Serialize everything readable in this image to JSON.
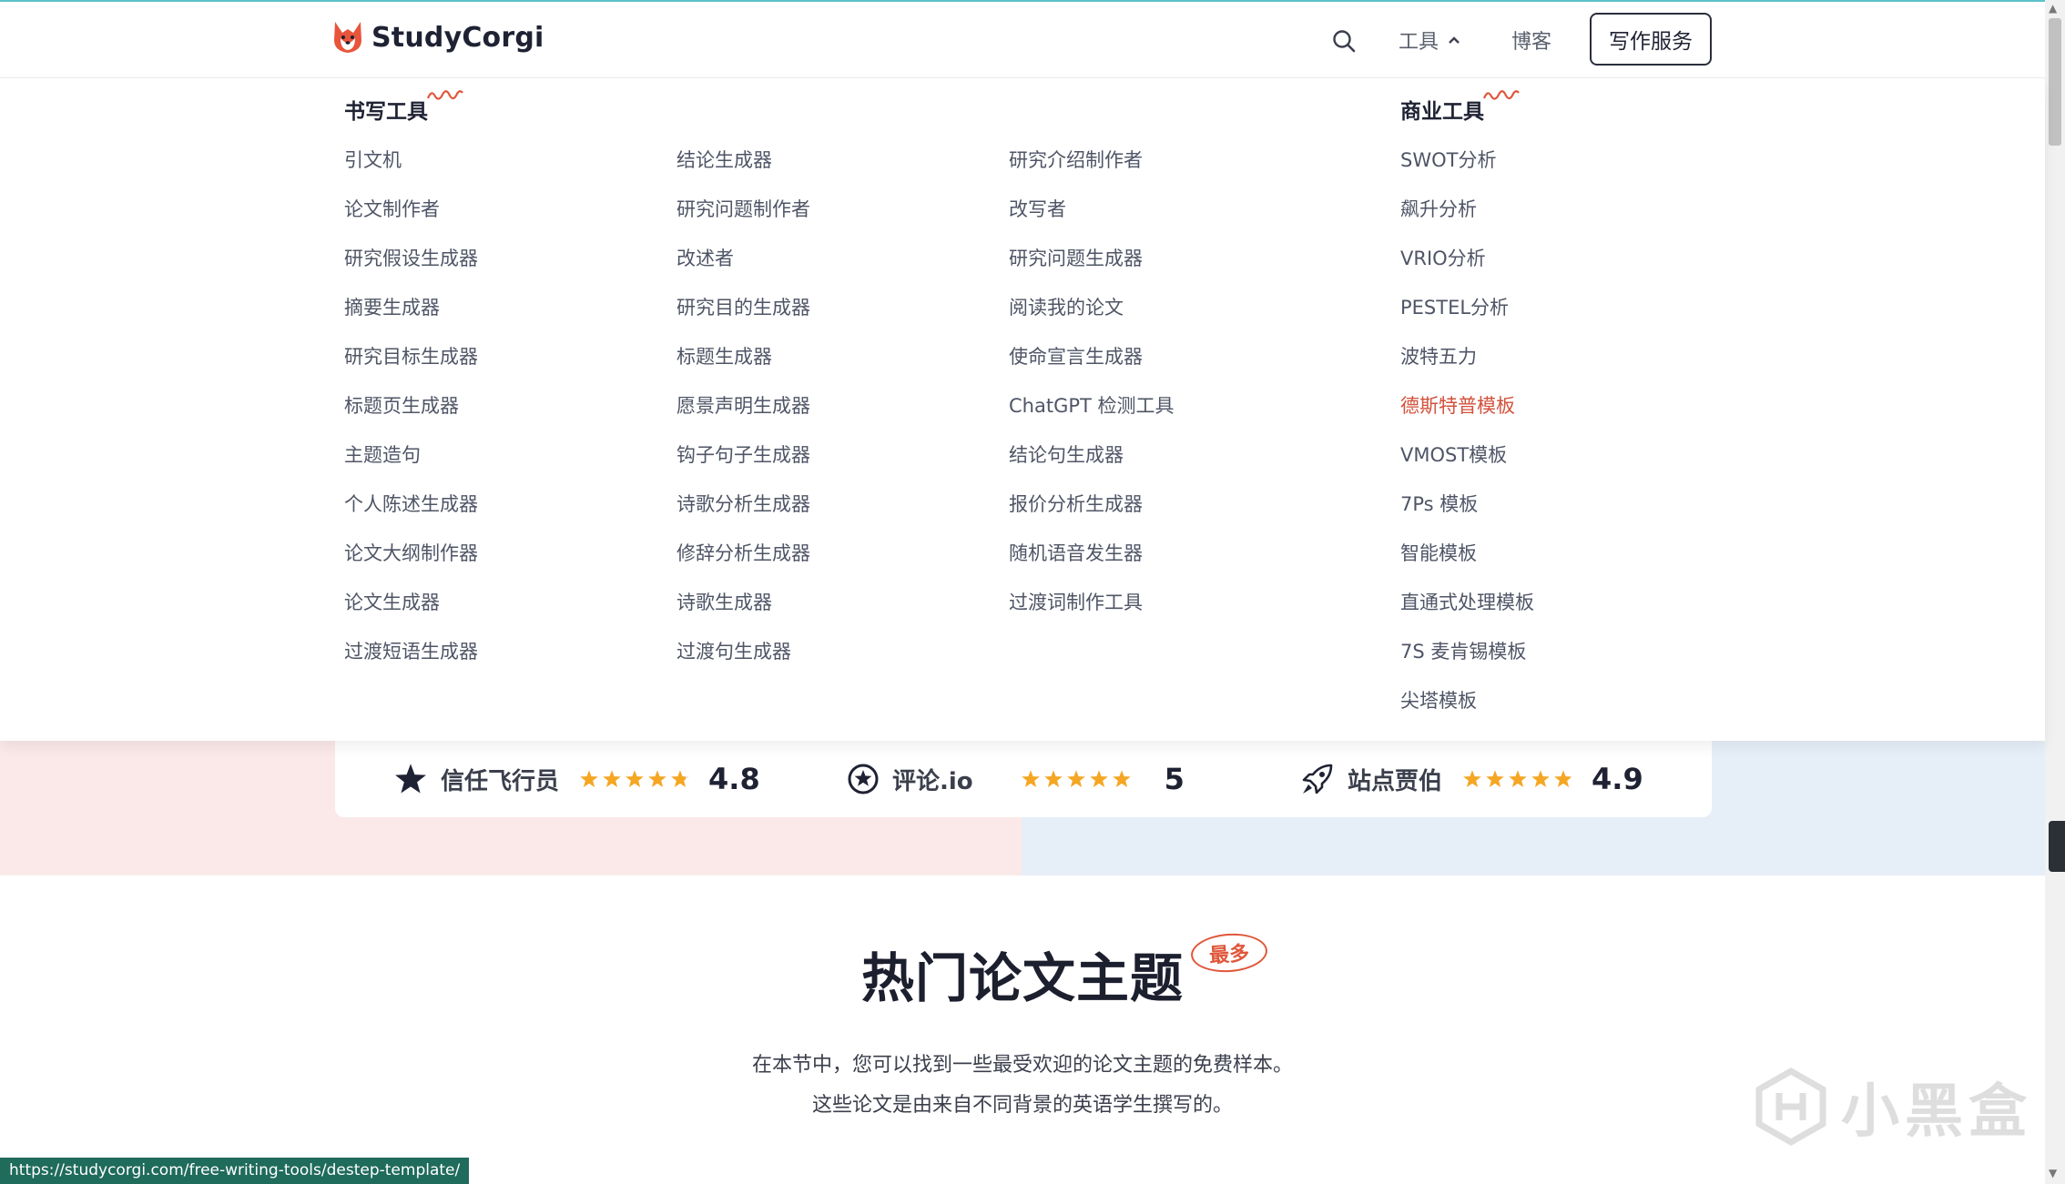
{
  "header": {
    "logo_text": "StudyCorgi",
    "tools_label": "工具",
    "blog_label": "博客",
    "cta_label": "写作服务"
  },
  "dropdown": {
    "writing_title": "书写工具",
    "business_title": "商业工具",
    "col1": [
      "引文机",
      "论文制作者",
      "研究假设生成器",
      "摘要生成器",
      "研究目标生成器",
      "标题页生成器",
      "主题造句",
      "个人陈述生成器",
      "论文大纲制作器",
      "论文生成器",
      "过渡短语生成器"
    ],
    "col2": [
      "结论生成器",
      "研究问题制作者",
      "改述者",
      "研究目的生成器",
      "标题生成器",
      "愿景声明生成器",
      "钩子句子生成器",
      "诗歌分析生成器",
      "修辞分析生成器",
      "诗歌生成器",
      "过渡句生成器"
    ],
    "col3": [
      "研究介绍制作者",
      "改写者",
      "研究问题生成器",
      "阅读我的论文",
      "使命宣言生成器",
      "ChatGPT 检测工具",
      "结论句生成器",
      "报价分析生成器",
      "随机语音发生器",
      "过渡词制作工具"
    ],
    "col4": [
      "SWOT分析",
      "飙升分析",
      "VRIO分析",
      "PESTEL分析",
      "波特五力",
      "德斯特普模板",
      "VMOST模板",
      "7Ps 模板",
      "智能模板",
      "直通式处理模板",
      "7S 麦肯锡模板",
      "尖塔模板"
    ],
    "active_item": "德斯特普模板"
  },
  "ratings": [
    {
      "name": "信任飞行员",
      "score": "4.8",
      "stars": 4.8,
      "icon": "star-icon"
    },
    {
      "name": "评论.io",
      "score": "5",
      "stars": 5,
      "icon": "badge-star-icon"
    },
    {
      "name": "站点贾伯",
      "score": "4.9",
      "stars": 4.9,
      "icon": "rocket-icon"
    }
  ],
  "popular": {
    "title": "热门论文主题",
    "badge": "最多",
    "desc_line1": "在本节中，您可以找到一些最受欢迎的论文主题的免费样本。",
    "desc_line2": "这些论文是由来自不同背景的英语学生撰写的。"
  },
  "status_url": "https://studycorgi.com/free-writing-tools/destep-template/",
  "watermark_text": "小黑盒",
  "colors": {
    "accent": "#d2523c",
    "star": "#f5a623",
    "band_left": "#fbe9e9",
    "band_right": "#e6eef8"
  }
}
